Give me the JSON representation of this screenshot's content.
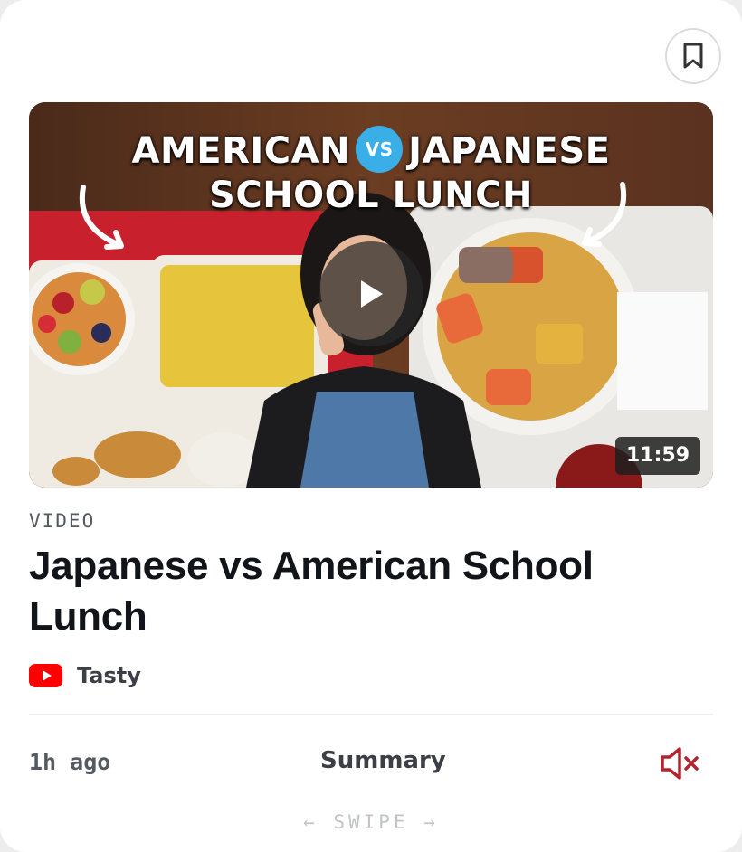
{
  "card": {
    "kind_label": "VIDEO",
    "title": "Japanese vs American School Lunch",
    "source_name": "Tasty",
    "source_icon": "youtube-icon",
    "time_ago": "1h ago",
    "summary_label": "Summary",
    "swipe_hint": "← SWIPE →"
  },
  "thumbnail": {
    "title_left": "AMERICAN",
    "vs_label": "VS",
    "title_right": "JAPANESE",
    "title_line2": "SCHOOL LUNCH",
    "duration": "11:59"
  },
  "icons": {
    "bookmark": "bookmark-icon",
    "play": "play-icon",
    "mute": "speaker-muted-icon"
  },
  "colors": {
    "accent_red": "#b5232f",
    "youtube_red": "#ff0000",
    "vs_blue": "#3aaee6"
  }
}
